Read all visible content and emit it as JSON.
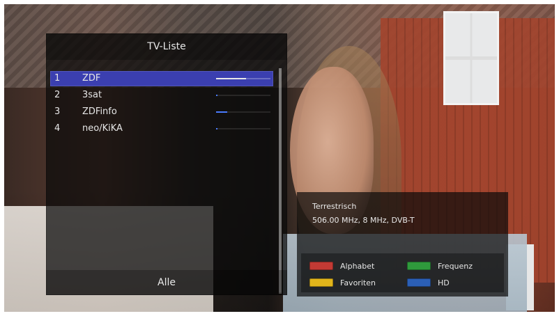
{
  "panel": {
    "title": "TV-Liste",
    "footer_label": "Alle",
    "channels": [
      {
        "number": "1",
        "name": "ZDF",
        "signal": 0.55,
        "selected": true
      },
      {
        "number": "2",
        "name": "3sat",
        "signal": 0.02,
        "selected": false
      },
      {
        "number": "3",
        "name": "ZDFinfo",
        "signal": 0.2,
        "selected": false
      },
      {
        "number": "4",
        "name": "neo/KiKA",
        "signal": 0.02,
        "selected": false
      }
    ]
  },
  "info": {
    "line1": "Terrestrisch",
    "line2": "506.00 MHz, 8 MHz, DVB-T"
  },
  "legend": {
    "items": [
      {
        "label": "Alphabet",
        "color": "#c23a34",
        "icon": "red-button-icon"
      },
      {
        "label": "Frequenz",
        "color": "#2f9a3c",
        "icon": "green-button-icon"
      },
      {
        "label": "Favoriten",
        "color": "#e2b51b",
        "icon": "yellow-button-icon"
      },
      {
        "label": "HD",
        "color": "#2b5fb6",
        "icon": "blue-button-icon"
      }
    ]
  },
  "colors": {
    "selected_row": "#3b3fb0",
    "signal_blue": "#4a7cff"
  }
}
